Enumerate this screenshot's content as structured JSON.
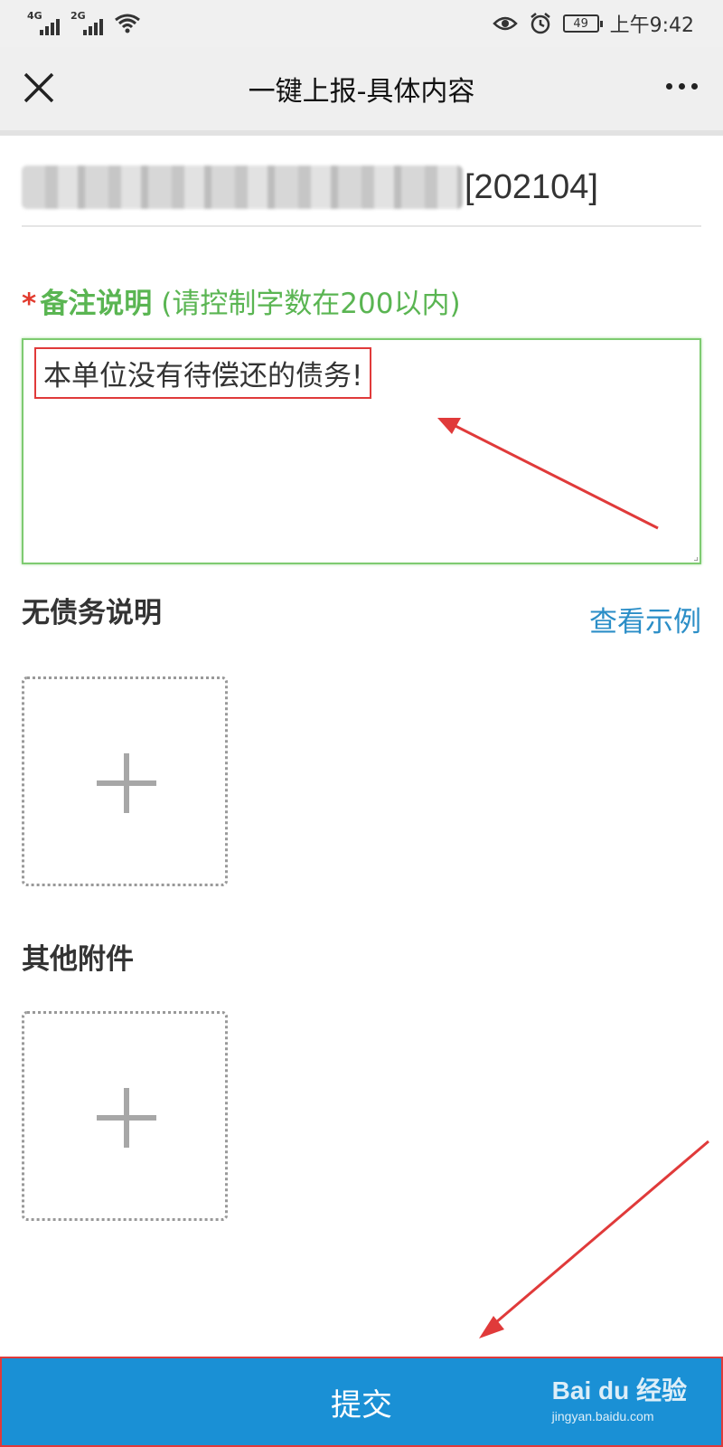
{
  "status": {
    "signal1_label": "4G",
    "signal2_label": "2G",
    "battery_level": "49",
    "time": "上午9:42",
    "icons": [
      "signal-icon",
      "wifi-icon",
      "eye-icon",
      "alarm-icon",
      "battery-icon"
    ]
  },
  "navbar": {
    "title": "一键上报-具体内容",
    "close_icon": "close-icon",
    "more_icon": "more-icon"
  },
  "header": {
    "period": "[202104]"
  },
  "remark": {
    "required_mark": "*",
    "label": "备注说明",
    "hint": "(请控制字数在200以内)",
    "value": "本单位没有待偿还的债务!"
  },
  "no_debt": {
    "title": "无债务说明",
    "example_link": "查看示例"
  },
  "other": {
    "title": "其他附件"
  },
  "submit": {
    "label": "提交"
  },
  "watermark": {
    "main": "Bai du 经验",
    "sub": "jingyan.baidu.com"
  },
  "colors": {
    "accent_green": "#5ab552",
    "link_blue": "#2b8ec7",
    "submit_blue": "#1a90d5",
    "annotation_red": "#e03a3a"
  }
}
